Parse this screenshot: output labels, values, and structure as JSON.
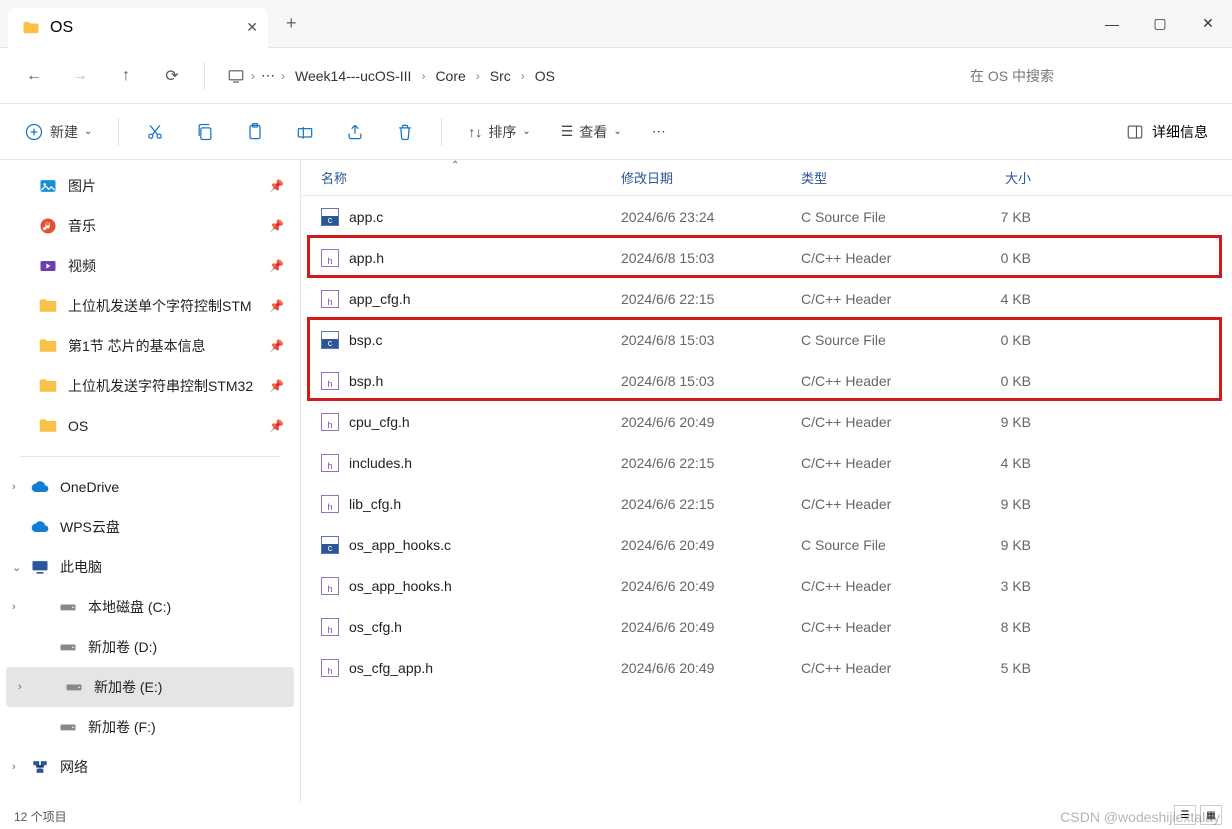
{
  "tab_title": "OS",
  "breadcrumb": [
    "Week14---ucOS-III",
    "Core",
    "Src",
    "OS"
  ],
  "search_placeholder": "在 OS 中搜索",
  "toolbar": {
    "new_label": "新建",
    "sort_label": "排序",
    "view_label": "查看",
    "detail_label": "详细信息"
  },
  "sidebar_pinned": [
    {
      "label": "图片",
      "icon": "image",
      "color": "#1a8fd6"
    },
    {
      "label": "音乐",
      "icon": "music",
      "color": "#e4512b"
    },
    {
      "label": "视频",
      "icon": "video",
      "color": "#6b3fb0"
    },
    {
      "label": "上位机发送单个字符控制STM",
      "icon": "folder"
    },
    {
      "label": "第1节 芯片的基本信息",
      "icon": "folder"
    },
    {
      "label": "上位机发送字符串控制STM32",
      "icon": "folder"
    },
    {
      "label": "OS",
      "icon": "folder"
    }
  ],
  "sidebar_tree": [
    {
      "label": "OneDrive",
      "icon": "cloud",
      "color": "#0f7dd4",
      "expand": "›"
    },
    {
      "label": "WPS云盘",
      "icon": "cloud",
      "color": "#0f7dd4"
    },
    {
      "label": "此电脑",
      "icon": "pc",
      "color": "#2a5599",
      "expand": "⌄",
      "children": [
        {
          "label": "本地磁盘 (C:)",
          "icon": "drive",
          "expand": "›"
        },
        {
          "label": "新加卷 (D:)",
          "icon": "drive"
        },
        {
          "label": "新加卷 (E:)",
          "icon": "drive",
          "selected": true,
          "expand": "›"
        },
        {
          "label": "新加卷 (F:)",
          "icon": "drive"
        }
      ]
    },
    {
      "label": "网络",
      "icon": "network",
      "color": "#2a5599",
      "expand": "›"
    }
  ],
  "columns": {
    "name": "名称",
    "date": "修改日期",
    "type": "类型",
    "size": "大小"
  },
  "files": [
    {
      "name": "app.c",
      "date": "2024/6/6 23:24",
      "type": "C Source File",
      "size": "7 KB",
      "icon": "c"
    },
    {
      "name": "app.h",
      "date": "2024/6/8 15:03",
      "type": "C/C++ Header",
      "size": "0 KB",
      "icon": "h",
      "hl": 1
    },
    {
      "name": "app_cfg.h",
      "date": "2024/6/6 22:15",
      "type": "C/C++ Header",
      "size": "4 KB",
      "icon": "h"
    },
    {
      "name": "bsp.c",
      "date": "2024/6/8 15:03",
      "type": "C Source File",
      "size": "0 KB",
      "icon": "c",
      "hl": 2
    },
    {
      "name": "bsp.h",
      "date": "2024/6/8 15:03",
      "type": "C/C++ Header",
      "size": "0 KB",
      "icon": "h",
      "hl": 2
    },
    {
      "name": "cpu_cfg.h",
      "date": "2024/6/6 20:49",
      "type": "C/C++ Header",
      "size": "9 KB",
      "icon": "h"
    },
    {
      "name": "includes.h",
      "date": "2024/6/6 22:15",
      "type": "C/C++ Header",
      "size": "4 KB",
      "icon": "h"
    },
    {
      "name": "lib_cfg.h",
      "date": "2024/6/6 22:15",
      "type": "C/C++ Header",
      "size": "9 KB",
      "icon": "h"
    },
    {
      "name": "os_app_hooks.c",
      "date": "2024/6/6 20:49",
      "type": "C Source File",
      "size": "9 KB",
      "icon": "c"
    },
    {
      "name": "os_app_hooks.h",
      "date": "2024/6/6 20:49",
      "type": "C/C++ Header",
      "size": "3 KB",
      "icon": "h"
    },
    {
      "name": "os_cfg.h",
      "date": "2024/6/6 20:49",
      "type": "C/C++ Header",
      "size": "8 KB",
      "icon": "h"
    },
    {
      "name": "os_cfg_app.h",
      "date": "2024/6/6 20:49",
      "type": "C/C++ Header",
      "size": "5 KB",
      "icon": "h"
    }
  ],
  "status": "12 个项目",
  "watermark": "CSDN @wodeshijiextalay"
}
